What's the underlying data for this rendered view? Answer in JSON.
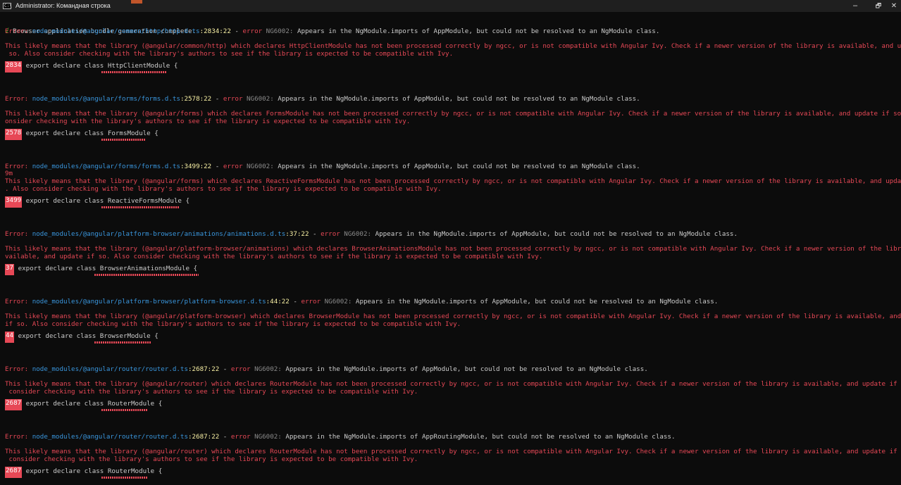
{
  "window": {
    "title": "Administrator: Командная строка",
    "icon_label": "C:\\",
    "buttons": {
      "minimize": "–",
      "maximize": "🗗",
      "close": "✕"
    }
  },
  "terminal": {
    "first_line": {
      "check": "√",
      "text": " Browser application bundle generation complete."
    },
    "errors": [
      {
        "prefix": "Error: ",
        "path": "node_modules/@angular/common/http/http.d.ts",
        "loc": ":2834:22",
        "sep": " - ",
        "err": "error",
        "code": " NG6002: ",
        "message": "Appears in the NgModule.imports of AppModule, but could not be resolved to an NgModule class.",
        "extra": "",
        "detail1": "This likely means that the library (@angular/common/http) which declares HttpClientModule has not been processed correctly by ngcc, or is not compatible with Angular Ivy. Check if a newer version of the library is available, and update if",
        "detail2": " so. Also consider checking with the library's authors to see if the library is expected to be compatible with Ivy.",
        "lineno": "2834",
        "code_line": " export declare class HttpClientModule {"
      },
      {
        "prefix": "Error: ",
        "path": "node_modules/@angular/forms/forms.d.ts",
        "loc": ":2578:22",
        "sep": " - ",
        "err": "error",
        "code": " NG6002: ",
        "message": "Appears in the NgModule.imports of AppModule, but could not be resolved to an NgModule class.",
        "extra": "",
        "detail1": "This likely means that the library (@angular/forms) which declares FormsModule has not been processed correctly by ngcc, or is not compatible with Angular Ivy. Check if a newer version of the library is available, and update if so. Also c",
        "detail2": "onsider checking with the library's authors to see if the library is expected to be compatible with Ivy.",
        "lineno": "2578",
        "code_line": " export declare class FormsModule {"
      },
      {
        "prefix": "Error: ",
        "path": "node_modules/@angular/forms/forms.d.ts",
        "loc": ":3499:22",
        "sep": " - ",
        "err": "error",
        "code": " NG6002: ",
        "message": "Appears in the NgModule.imports of AppModule, but could not be resolved to an NgModule class.",
        "extra": "9m",
        "detail1": "This likely means that the library (@angular/forms) which declares ReactiveFormsModule has not been processed correctly by ngcc, or is not compatible with Angular Ivy. Check if a newer version of the library is available, and update if so",
        "detail2": ". Also consider checking with the library's authors to see if the library is expected to be compatible with Ivy.",
        "lineno": "3499",
        "code_line": " export declare class ReactiveFormsModule {"
      },
      {
        "prefix": "Error: ",
        "path": "node_modules/@angular/platform-browser/animations/animations.d.ts",
        "loc": ":37:22",
        "sep": " - ",
        "err": "error",
        "code": " NG6002: ",
        "message": "Appears in the NgModule.imports of AppModule, but could not be resolved to an NgModule class.",
        "extra": "",
        "detail1": "This likely means that the library (@angular/platform-browser/animations) which declares BrowserAnimationsModule has not been processed correctly by ngcc, or is not compatible with Angular Ivy. Check if a newer version of the library is a",
        "detail2": "vailable, and update if so. Also consider checking with the library's authors to see if the library is expected to be compatible with Ivy.",
        "lineno": "37",
        "code_line": " export declare class BrowserAnimationsModule {"
      },
      {
        "prefix": "Error: ",
        "path": "node_modules/@angular/platform-browser/platform-browser.d.ts",
        "loc": ":44:22",
        "sep": " - ",
        "err": "error",
        "code": " NG6002: ",
        "message": "Appears in the NgModule.imports of AppModule, but could not be resolved to an NgModule class.",
        "extra": "",
        "detail1": "This likely means that the library (@angular/platform-browser) which declares BrowserModule has not been processed correctly by ngcc, or is not compatible with Angular Ivy. Check if a newer version of the library is available, and update",
        "detail2": "if so. Also consider checking with the library's authors to see if the library is expected to be compatible with Ivy.",
        "lineno": "44",
        "code_line": " export declare class BrowserModule {"
      },
      {
        "prefix": "Error: ",
        "path": "node_modules/@angular/router/router.d.ts",
        "loc": ":2687:22",
        "sep": " - ",
        "err": "error",
        "code": " NG6002: ",
        "message": "Appears in the NgModule.imports of AppModule, but could not be resolved to an NgModule class.",
        "extra": "",
        "detail1": "This likely means that the library (@angular/router) which declares RouterModule has not been processed correctly by ngcc, or is not compatible with Angular Ivy. Check if a newer version of the library is available, and update if so. Also",
        "detail2": " consider checking with the library's authors to see if the library is expected to be compatible with Ivy.",
        "lineno": "2687",
        "code_line": " export declare class RouterModule {"
      },
      {
        "prefix": "Error: ",
        "path": "node_modules/@angular/router/router.d.ts",
        "loc": ":2687:22",
        "sep": " - ",
        "err": "error",
        "code": " NG6002: ",
        "message": "Appears in the NgModule.imports of AppRoutingModule, but could not be resolved to an NgModule class.",
        "extra": "",
        "detail1": "This likely means that the library (@angular/router) which declares RouterModule has not been processed correctly by ngcc, or is not compatible with Angular Ivy. Check if a newer version of the library is available, and update if so. Also",
        "detail2": " consider checking with the library's authors to see if the library is expected to be compatible with Ivy.",
        "lineno": "2687",
        "code_line": " export declare class RouterModule {"
      }
    ]
  }
}
